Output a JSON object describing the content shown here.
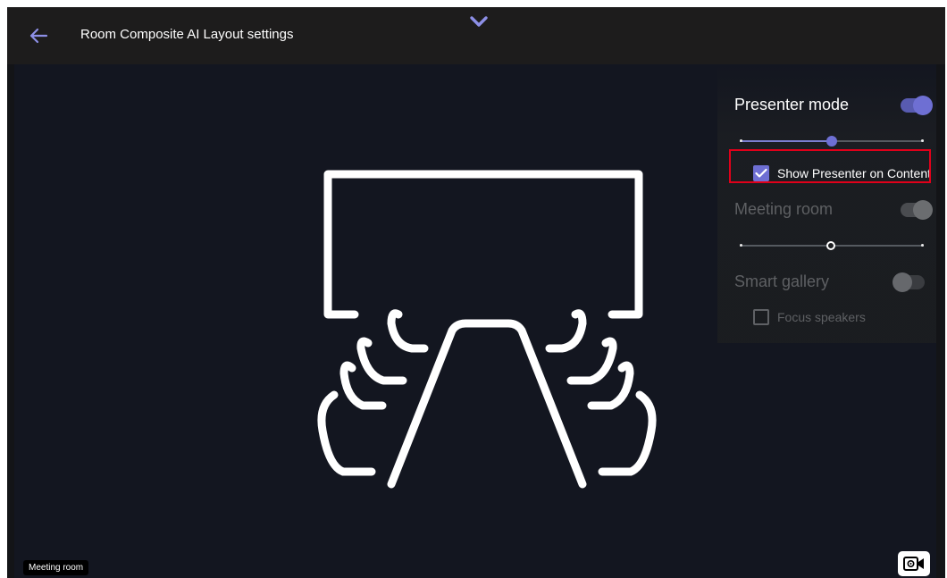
{
  "header": {
    "title": "Room Composite AI Layout settings"
  },
  "settings": {
    "presenter_mode": {
      "label": "Presenter mode",
      "enabled": true,
      "slider_value": 0.5
    },
    "show_presenter_on_content": {
      "label": "Show Presenter on Content",
      "checked": true
    },
    "meeting_room": {
      "label": "Meeting room",
      "enabled": true,
      "slider_value": 0.5
    },
    "smart_gallery": {
      "label": "Smart gallery",
      "enabled": false
    },
    "focus_speakers": {
      "label": "Focus speakers",
      "checked": false
    }
  },
  "footer": {
    "room_tag": "Meeting room"
  },
  "icons": {
    "back": "arrow-left-icon",
    "collapse": "chevron-down-icon",
    "camera": "camera-settings-icon",
    "illustration": "conference-room-icon"
  },
  "colors": {
    "accent": "#6e6fd3",
    "highlight": "#e0001a",
    "background": "#131620"
  }
}
